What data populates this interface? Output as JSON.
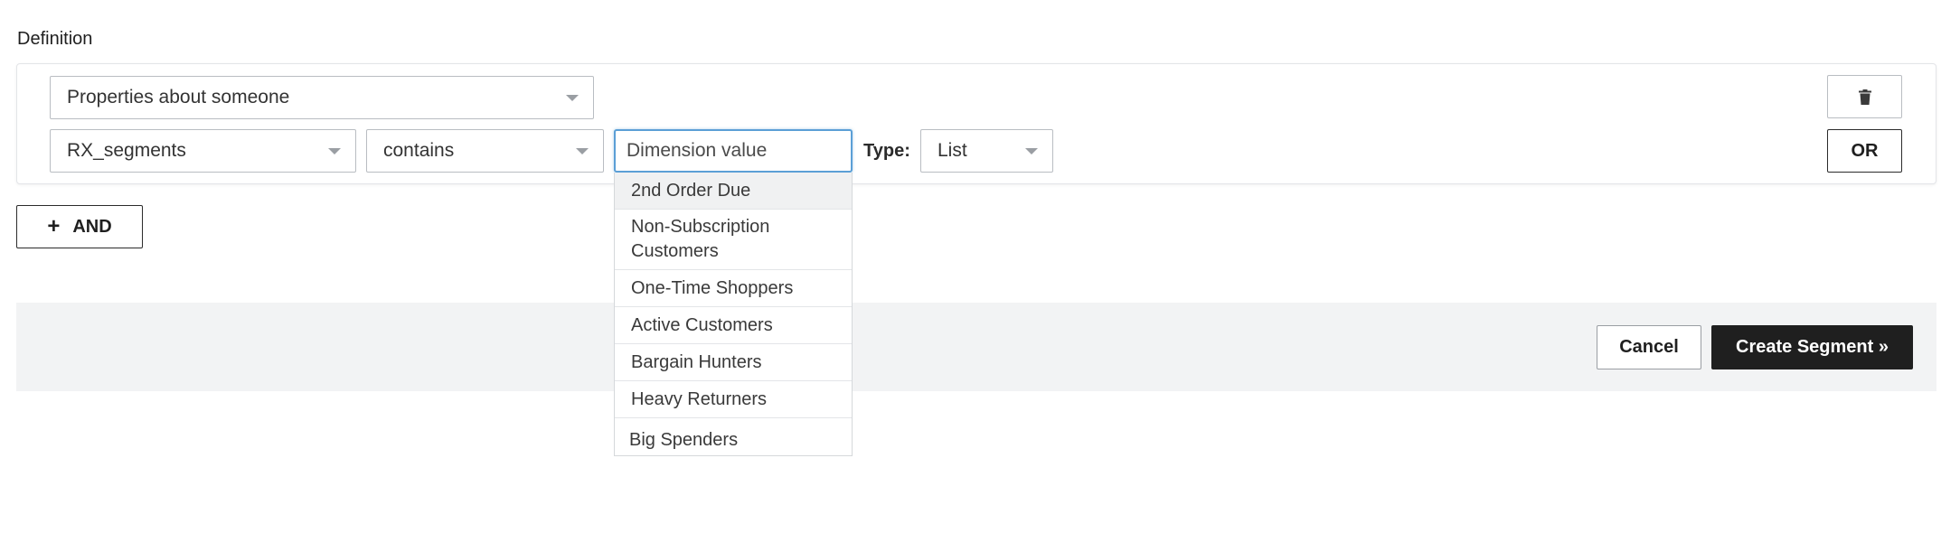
{
  "definition": {
    "section_label": "Definition",
    "properties_select": {
      "value": "Properties about someone"
    },
    "field_select": {
      "value": "RX_segments"
    },
    "operator_select": {
      "value": "contains"
    },
    "dimension_input": {
      "placeholder": "Dimension value",
      "value": ""
    },
    "type_label": "Type:",
    "type_select": {
      "value": "List"
    },
    "trash_button": {
      "icon": "trash-icon"
    },
    "or_button": {
      "label": "OR"
    }
  },
  "and_button": {
    "icon": "plus-icon",
    "label": "AND"
  },
  "dropdown": {
    "items": [
      {
        "label": "2nd Order Due",
        "highlighted": true
      },
      {
        "label": "Non-Subscription Customers",
        "highlighted": false
      },
      {
        "label": "One-Time Shoppers",
        "highlighted": false
      },
      {
        "label": "Active Customers",
        "highlighted": false
      },
      {
        "label": "Bargain Hunters",
        "highlighted": false
      },
      {
        "label": "Heavy Returners",
        "highlighted": false
      },
      {
        "label": "Big Spenders",
        "highlighted": false
      }
    ]
  },
  "footer": {
    "cancel_label": "Cancel",
    "create_label": "Create Segment »"
  },
  "colors": {
    "focus_border": "#5b9fd6",
    "primary_button": "#1f1f1f",
    "footer_background": "#f2f3f4"
  }
}
